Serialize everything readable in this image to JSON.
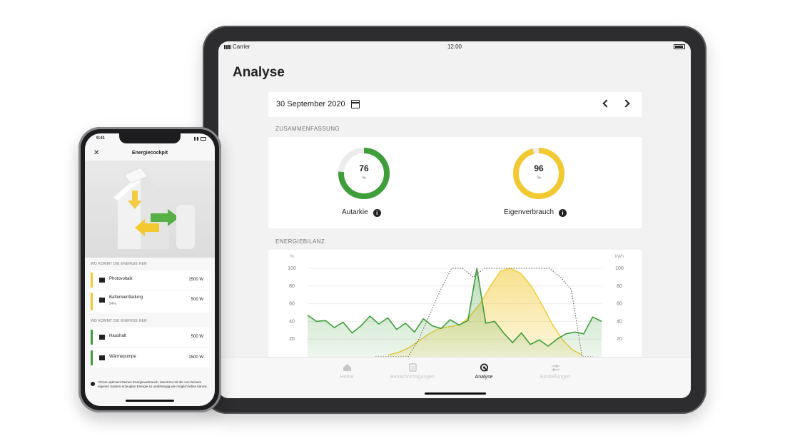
{
  "tablet": {
    "status": {
      "carrier": "Carrier",
      "time": "12:00"
    },
    "title": "Analyse",
    "date": "30 September 2020",
    "summary": {
      "section_label": "ZUSAMMENFASSUNG",
      "autarkie": {
        "value": "76",
        "unit": "%",
        "label": "Autarkie",
        "fraction": 0.76,
        "color": "#3e9e3a"
      },
      "eigenverbrauch": {
        "value": "96",
        "unit": "%",
        "label": "Eigenverbrauch",
        "fraction": 0.96,
        "color": "#f2c931"
      }
    },
    "energy": {
      "section_label": "ENERGIEBILANZ",
      "left_unit": "%",
      "right_unit": "kWh",
      "y_ticks": [
        "100",
        "80",
        "60",
        "40",
        "20"
      ]
    },
    "tabs": [
      {
        "label": "Home",
        "icon": "home-icon",
        "active": false
      },
      {
        "label": "Benachrichtigungen",
        "icon": "notifications-icon",
        "active": false
      },
      {
        "label": "Analyse",
        "icon": "analyse-icon",
        "active": true
      },
      {
        "label": "Einstellungen",
        "icon": "settings-icon",
        "active": false
      }
    ]
  },
  "chart_data": {
    "type": "line",
    "title": "",
    "xlabel": "",
    "ylabel": "%",
    "ylabel_right": "kWh",
    "ylim": [
      0,
      100
    ],
    "y_ticks": [
      20,
      40,
      60,
      80,
      100
    ],
    "grid": true,
    "series": [
      {
        "values": [
          47,
          40,
          41,
          33,
          39,
          27,
          35,
          46,
          37,
          44,
          31,
          38,
          28,
          43,
          35,
          32,
          42,
          36,
          41,
          100,
          38,
          40,
          27,
          16,
          27,
          14,
          19,
          12,
          20,
          26,
          28,
          26,
          45,
          40
        ]
      },
      {
        "values": [
          2,
          5,
          10,
          18,
          26,
          32,
          34,
          36,
          46,
          60,
          80,
          97,
          100,
          94,
          80,
          60,
          38,
          20,
          8,
          2
        ]
      },
      {
        "values": [
          0,
          0,
          0,
          0,
          20,
          48,
          76,
          100,
          100,
          90,
          100,
          100,
          100,
          100,
          100,
          100,
          100,
          90,
          76,
          0,
          0
        ]
      }
    ],
    "colors": [
      "#3e9e3a",
      "#f2c931",
      "#555555"
    ]
  },
  "phone": {
    "time": "9:41",
    "title": "Energiecockpit",
    "section_from": "WO KOMMT DIE ENERGIE HER",
    "section_to": "WO KOMMT DIE ENERGIE HER",
    "sources": [
      {
        "label": "Photovoltaik",
        "sub": "",
        "value": "1500 W",
        "color": "#f2c931",
        "icon": "solar-icon"
      },
      {
        "label": "Batterieentladung",
        "sub": "54%",
        "value": "500 W",
        "color": "#f2c931",
        "icon": "battery-icon"
      }
    ],
    "consumers": [
      {
        "label": "Haushalt",
        "sub": "",
        "value": "500 W",
        "color": "#3e9e3a",
        "icon": "house-icon"
      },
      {
        "label": "Wärmepumpe",
        "sub": "",
        "value": "1500 W",
        "color": "#3e9e3a",
        "icon": "heatpump-icon"
      }
    ],
    "note": "ViCare optimiert Deinen Energieverbrauch, damit Du mit der von Deinem eigenen System erzeugten Energie so unabhängig wie möglich leben kannst."
  }
}
